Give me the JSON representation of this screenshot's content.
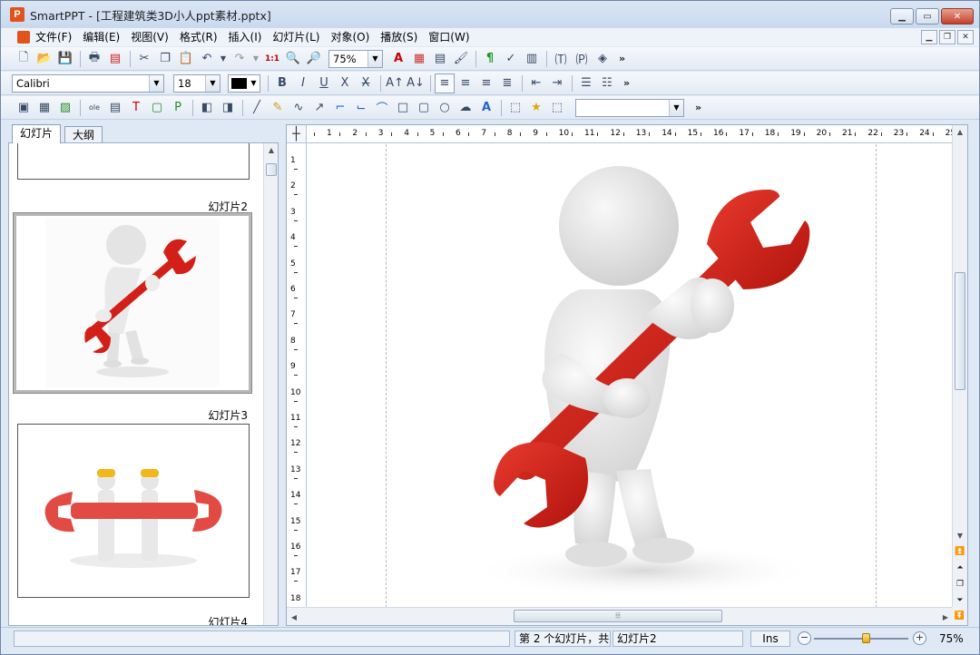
{
  "window": {
    "app_name": "SmartPPT",
    "title": "SmartPPT - [工程建筑类3D小人ppt素材.pptx]",
    "app_icon_letter": "P"
  },
  "menu": {
    "items": [
      "文件(F)",
      "编辑(E)",
      "视图(V)",
      "格式(R)",
      "插入(I)",
      "幻灯片(L)",
      "对象(O)",
      "播放(S)",
      "窗口(W)"
    ]
  },
  "toolbar1": {
    "zoom_value": "75%",
    "more": "»"
  },
  "toolbar2": {
    "font_name": "Calibri",
    "font_size": "18",
    "font_color": "#000000",
    "more": "»"
  },
  "toolbar3": {
    "shape_combo_value": "",
    "more": "»"
  },
  "left_pane": {
    "tabs": [
      "幻灯片",
      "大纲"
    ],
    "active_tab": "幻灯片",
    "slides": [
      {
        "label": "幻灯片2",
        "selected": true
      },
      {
        "label": "幻灯片3",
        "selected": false
      },
      {
        "label": "幻灯片4",
        "selected": false
      }
    ]
  },
  "ruler": {
    "horizontal": [
      "1",
      "2",
      "3",
      "4",
      "5",
      "6",
      "7",
      "8",
      "9",
      "10",
      "11",
      "12",
      "13",
      "14",
      "15",
      "16",
      "17",
      "18",
      "19",
      "20",
      "21",
      "22",
      "23",
      "24",
      "25"
    ],
    "vertical": [
      "1",
      "2",
      "3",
      "4",
      "5",
      "6",
      "7",
      "8",
      "9",
      "10",
      "11",
      "12",
      "13",
      "14",
      "15",
      "16",
      "17",
      "18"
    ]
  },
  "status": {
    "left": "",
    "slide_info": "第 2 个幻灯片，共",
    "slide_name": "幻灯片2",
    "mode": "Ins",
    "zoom": "75%",
    "zoom_level_fraction": 0.55
  },
  "colors": {
    "wrench_red": "#d21f17",
    "figure_white": "#e9e9e9",
    "helmet_yellow": "#f2b61a"
  }
}
